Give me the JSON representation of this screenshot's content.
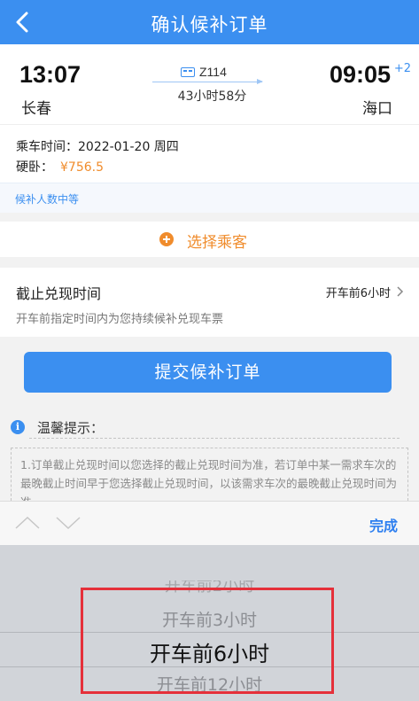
{
  "header": {
    "title": "确认候补订单"
  },
  "train": {
    "departure_time": "13:07",
    "departure_station": "长春",
    "arrival_time": "09:05",
    "day_offset": "+2",
    "arrival_station": "海口",
    "train_no": "Z114",
    "duration": "43小时58分"
  },
  "info": {
    "date_label": "乘车时间：",
    "date_value": "2022-01-20 周四",
    "seat_label": "硬卧：",
    "price": "¥756.5",
    "queue_status": "候补人数中等"
  },
  "passenger": {
    "label": "选择乘客"
  },
  "deadline": {
    "label": "截止兑现时间",
    "value": "开车前6小时",
    "description": "开车前指定时间内为您持续候补兑现车票"
  },
  "submit": {
    "label": "提交候补订单"
  },
  "tips": {
    "title": "温馨提示：",
    "text": "1.订单截止兑现时间以您选择的截止兑现时间为准，若订单中某一需求车次的最晚截止时间早于您选择截止兑现时间，以该需求车次的最晚截止兑现时间为准。"
  },
  "picker": {
    "done_label": "完成",
    "options": [
      "开车前2小时",
      "开车前3小时",
      "开车前6小时",
      "开车前12小时"
    ],
    "selected": "开车前6小时"
  },
  "colors": {
    "primary": "#3b8ff0",
    "accent": "#f08c2c",
    "highlight": "#e5303a"
  }
}
